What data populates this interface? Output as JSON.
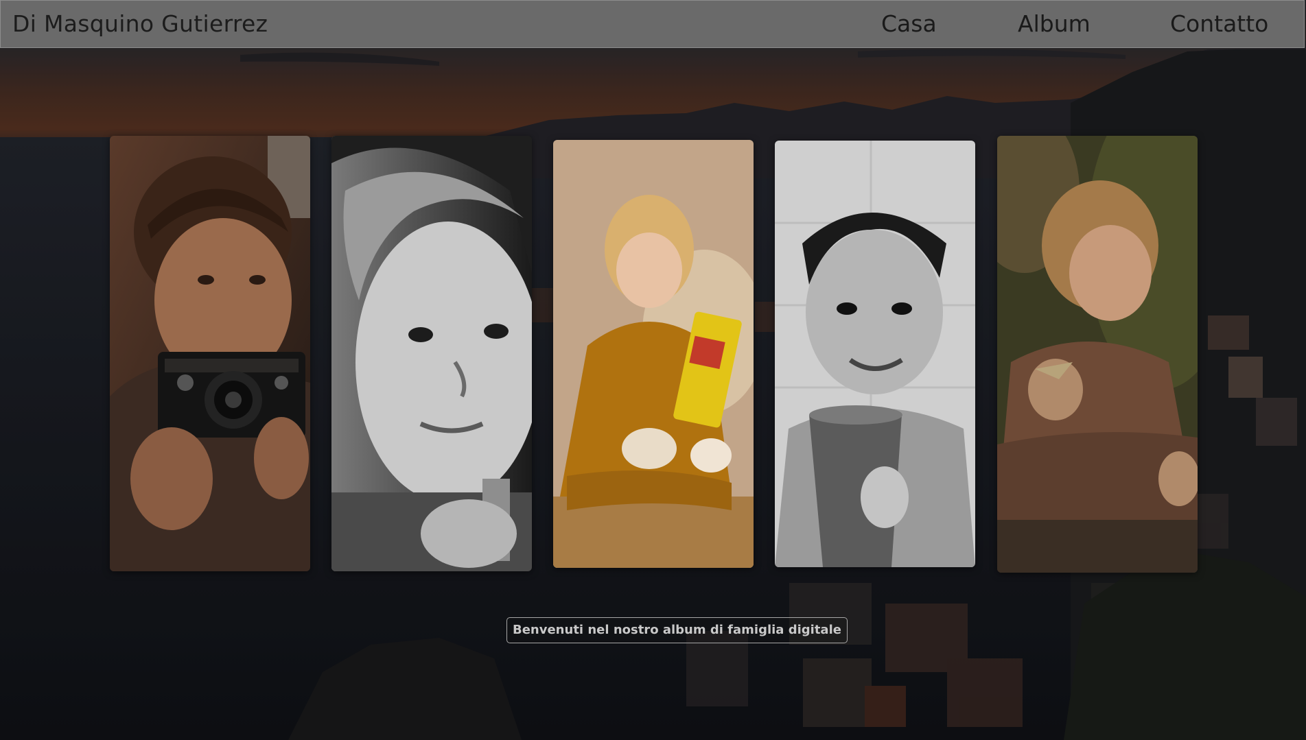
{
  "header": {
    "brand": "Di Masquino Gutierrez",
    "nav": [
      "Casa",
      "Album",
      "Contatto"
    ]
  },
  "gallery": {
    "photos": [
      {
        "subject": "child-with-camera",
        "tone": "warm"
      },
      {
        "subject": "child-portrait-bw",
        "tone": "black-and-white"
      },
      {
        "subject": "toddler-reading-book",
        "tone": "warm"
      },
      {
        "subject": "child-with-cup-bw",
        "tone": "black-and-white"
      },
      {
        "subject": "toddler-eating-biscuit",
        "tone": "warm"
      }
    ]
  },
  "welcome_text": "Benvenuti nel nostro album di famiglia digitale",
  "colors": {
    "navbar_bg": "#6a6a6a",
    "nav_text": "#1a1a1a",
    "welcome_border": "#a7a7a7",
    "welcome_text": "#c9c9c9"
  }
}
